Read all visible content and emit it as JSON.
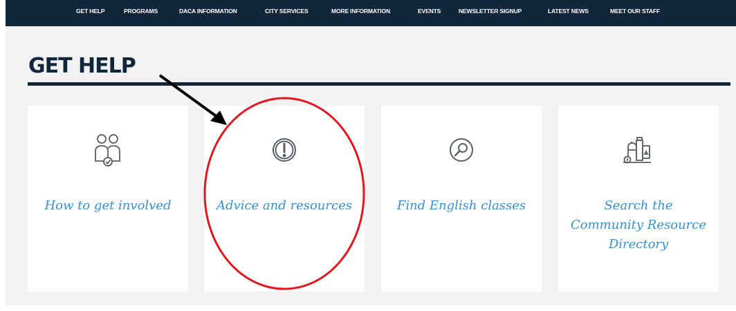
{
  "nav": {
    "items": [
      "GET HELP",
      "PROGRAMS",
      "DACA INFORMATION",
      "CITY SERVICES",
      "MORE INFORMATION",
      "EVENTS",
      "NEWSLETTER SIGNUP",
      "LATEST NEWS",
      "MEET OUR STAFF"
    ]
  },
  "page": {
    "title": "GET HELP"
  },
  "cards": [
    {
      "label": "How to get involved",
      "icon": "people-check-icon"
    },
    {
      "label": "Advice and resources",
      "icon": "exclamation-circle-icon"
    },
    {
      "label": "Find English classes",
      "icon": "magnifier-circle-icon"
    },
    {
      "label": "Search the Community Resource Directory",
      "icon": "city-buildings-icon"
    }
  ],
  "annotation": {
    "arrow_color": "#000000",
    "ellipse_color": "#e8141b"
  },
  "colors": {
    "nav_background": "#10263a",
    "title": "#10263a",
    "link": "#3a8fd1",
    "page_background": "#f2f2f2"
  }
}
